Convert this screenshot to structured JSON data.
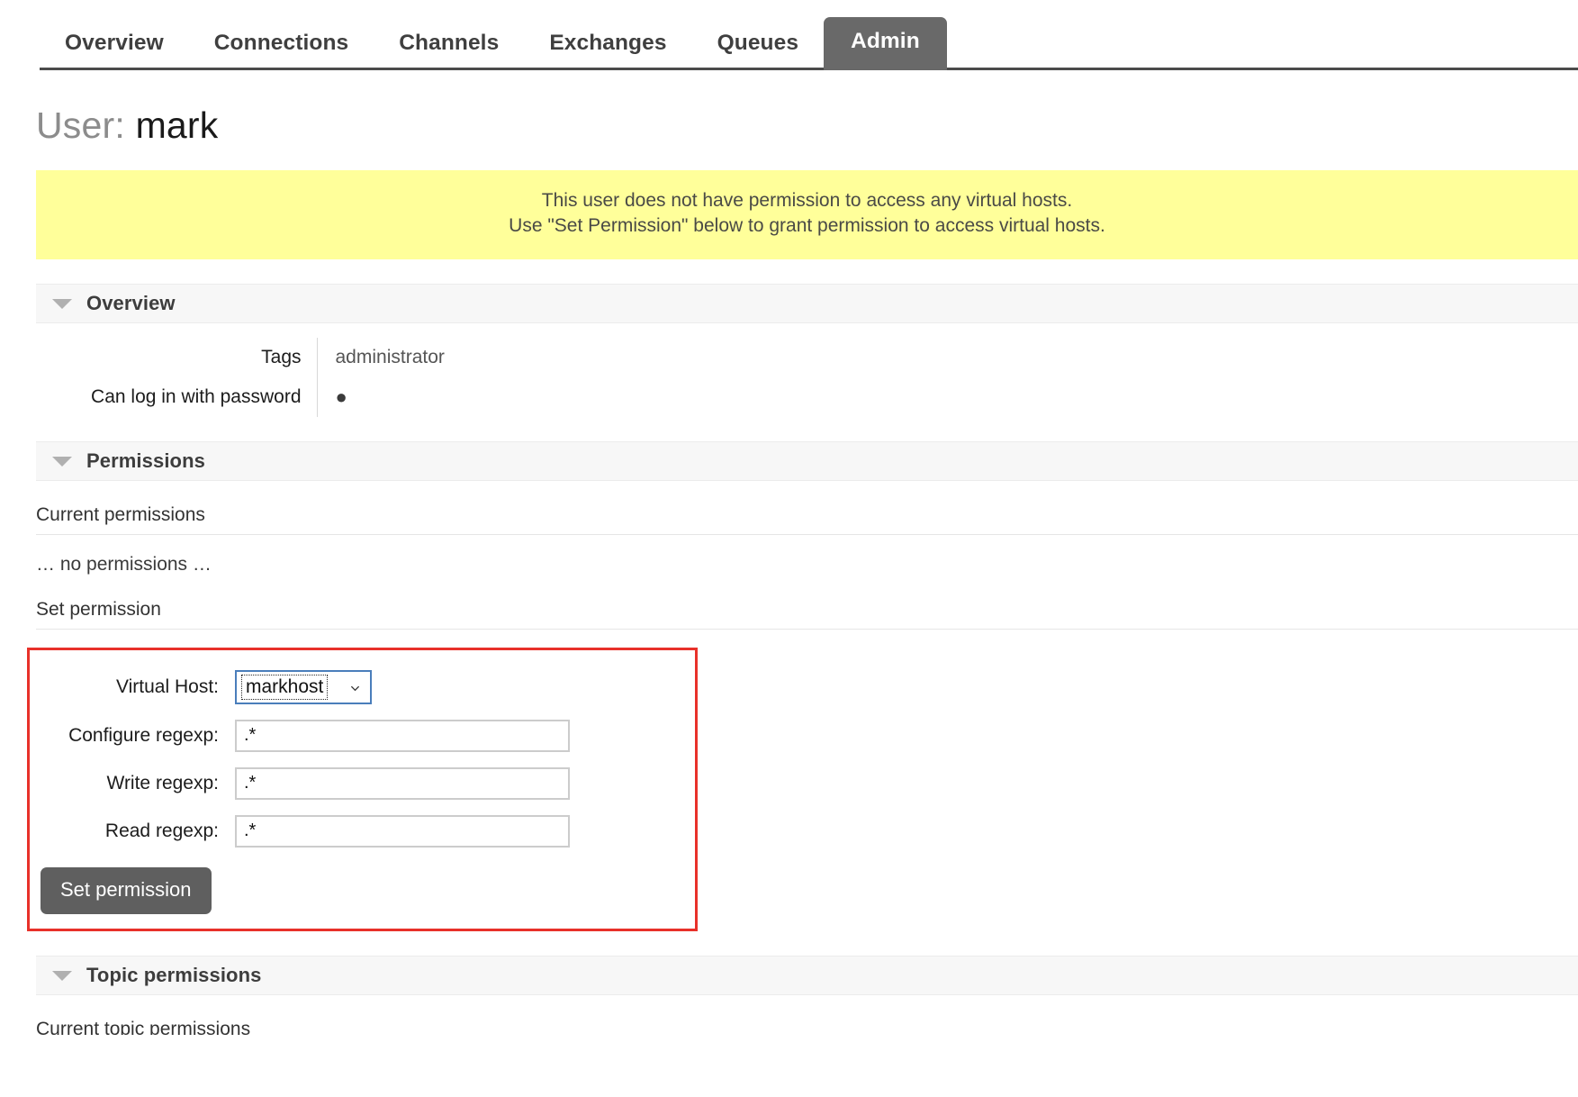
{
  "nav": {
    "tabs": [
      {
        "label": "Overview",
        "active": false
      },
      {
        "label": "Connections",
        "active": false
      },
      {
        "label": "Channels",
        "active": false
      },
      {
        "label": "Exchanges",
        "active": false
      },
      {
        "label": "Queues",
        "active": false
      },
      {
        "label": "Admin",
        "active": true
      }
    ]
  },
  "page": {
    "title_prefix": "User:",
    "title_name": "mark"
  },
  "banner": {
    "line1": "This user does not have permission to access any virtual hosts.",
    "line2": "Use \"Set Permission\" below to grant permission to access virtual hosts.",
    "background": "#ffff9a"
  },
  "overview": {
    "section_label": "Overview",
    "rows": [
      {
        "key": "Tags",
        "value": "administrator"
      },
      {
        "key": "Can log in with password",
        "value": "●"
      }
    ]
  },
  "permissions": {
    "section_label": "Permissions",
    "current_label": "Current permissions",
    "empty_text": "… no permissions …",
    "set_label": "Set permission",
    "form": {
      "vhost_label": "Virtual Host:",
      "vhost_value": "markhost",
      "configure_label": "Configure regexp:",
      "configure_value": ".*",
      "write_label": "Write regexp:",
      "write_value": ".*",
      "read_label": "Read regexp:",
      "read_value": ".*",
      "submit_label": "Set permission",
      "highlight_color": "#e8312a"
    }
  },
  "topic_permissions": {
    "section_label": "Topic permissions",
    "current_label": "Current topic permissions"
  }
}
